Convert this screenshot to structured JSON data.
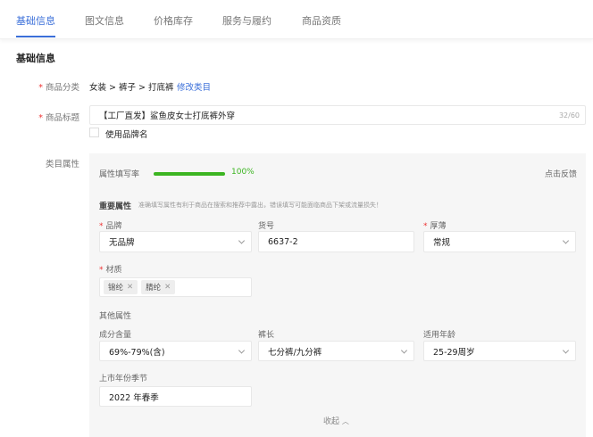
{
  "tabs": [
    "基础信息",
    "图文信息",
    "价格库存",
    "服务与履约",
    "商品资质"
  ],
  "section_title": "基础信息",
  "category": {
    "label": "商品分类",
    "value": "女装 > 裤子 > 打底裤",
    "edit_link": "修改类目"
  },
  "title": {
    "label": "商品标题",
    "value": "【工厂直发】鲨鱼皮女士打底裤外穿",
    "counter": "32/60",
    "brand_checkbox": "使用品牌名"
  },
  "attrs": {
    "label": "类目属性",
    "fill_rate_label": "属性填写率",
    "fill_rate_value": "100%",
    "fill_rate": 1.0,
    "feedback": "点击反馈",
    "important_title": "重要属性",
    "important_hint": "准确填写属性有利于商品在搜索和推荐中露出，错误填写可能面临商品下架或流量损失！",
    "brand": {
      "label": "品牌",
      "value": "无品牌"
    },
    "item_no": {
      "label": "货号",
      "value": "6637-2"
    },
    "thickness": {
      "label": "厚薄",
      "value": "常规"
    },
    "material": {
      "label": "材质",
      "tags": [
        "锦纶",
        "腈纶"
      ]
    },
    "other_title": "其他属性",
    "composition": {
      "label": "成分含量",
      "value": "69%-79%(含)"
    },
    "pants_length": {
      "label": "裤长",
      "value": "七分裤/九分裤"
    },
    "age": {
      "label": "适用年龄",
      "value": "25-29周岁"
    },
    "season": {
      "label": "上市年份季节",
      "value": "2022 年春季"
    },
    "collapse": "收起"
  },
  "colors": {
    "accent": "#3b6fd9",
    "progress": "#3cb521",
    "required": "#e33333"
  }
}
